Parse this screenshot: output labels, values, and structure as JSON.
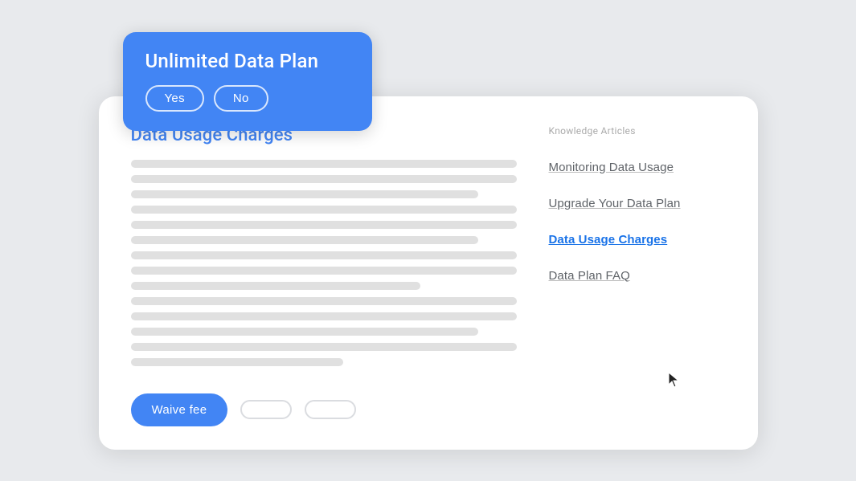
{
  "tooltip": {
    "title": "Unlimited Data Plan",
    "yes_label": "Yes",
    "no_label": "No"
  },
  "article": {
    "title": "Data Usage Charges",
    "lines": [
      "long",
      "long",
      "medium",
      "long",
      "long",
      "medium",
      "long",
      "long",
      "short",
      "long",
      "long",
      "medium",
      "long",
      "long",
      "xshort"
    ]
  },
  "sidebar": {
    "label": "Knowledge Articles",
    "links": [
      {
        "text": "Monitoring Data Usage",
        "active": false
      },
      {
        "text": "Upgrade Your Data Plan",
        "active": false
      },
      {
        "text": "Data Usage Charges",
        "active": true
      },
      {
        "text": "Data Plan FAQ",
        "active": false
      }
    ]
  },
  "footer": {
    "waive_label": "Waive fee",
    "btn2_label": "",
    "btn3_label": ""
  }
}
